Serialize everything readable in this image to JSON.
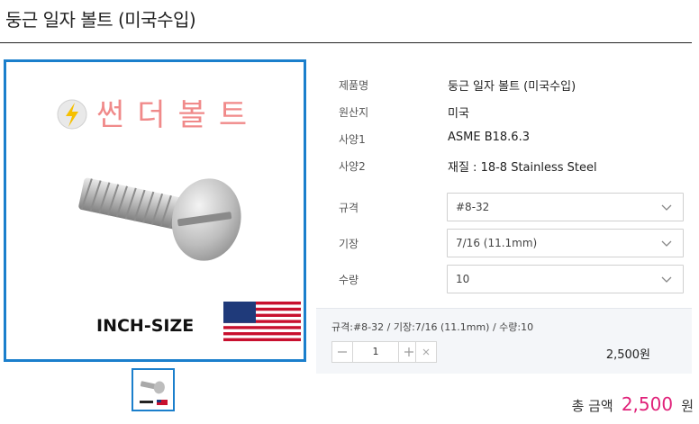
{
  "page": {
    "title": "둥근 일자 볼트 (미국수입)"
  },
  "image": {
    "brand_text": "썬더볼트",
    "caption": "INCH-SIZE",
    "flag": "us-flag"
  },
  "info": [
    {
      "label": "제품명",
      "value": "둥근 일자 볼트 (미국수입)"
    },
    {
      "label": "원산지",
      "value": "미국"
    },
    {
      "label": "사양1",
      "value": "ASME B18.6.3"
    },
    {
      "label": "사양2",
      "value": "재질 : 18-8 Stainless Steel"
    }
  ],
  "options": [
    {
      "label": "규격",
      "value": "#8-32"
    },
    {
      "label": "기장",
      "value": "7/16 (11.1mm)"
    },
    {
      "label": "수량",
      "value": "10"
    }
  ],
  "selection": {
    "summary": "규격:#8-32 / 기장:7/16 (11.1mm) / 수량:10",
    "quantity": "1",
    "price": "2,500원",
    "icons": {
      "minus": "minus-icon",
      "plus": "plus-icon",
      "remove": "close-icon"
    }
  },
  "total": {
    "label": "총 금액",
    "amount": "2,500",
    "unit": "원"
  },
  "colors": {
    "accent_border": "#1b7fcc",
    "total_amount": "#e0227a",
    "brand_red": "#f08a8a"
  }
}
